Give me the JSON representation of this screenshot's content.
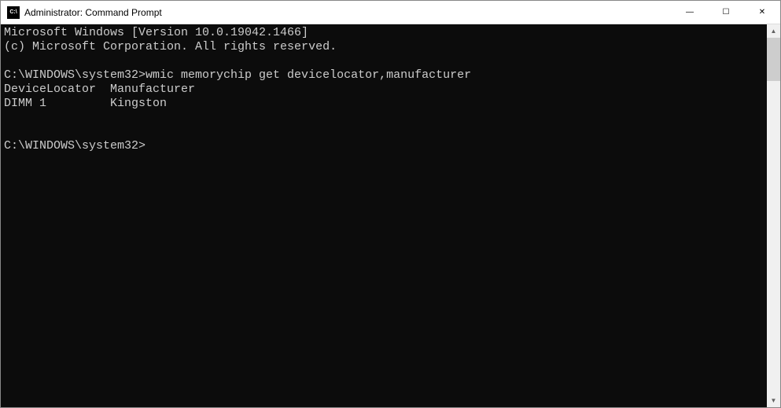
{
  "titlebar": {
    "icon_label": "C:\\",
    "title": "Administrator: Command Prompt"
  },
  "window_controls": {
    "minimize": "—",
    "maximize": "☐",
    "close": "✕"
  },
  "terminal": {
    "line1": "Microsoft Windows [Version 10.0.19042.1466]",
    "line2": "(c) Microsoft Corporation. All rights reserved.",
    "blank1": "",
    "line3": "C:\\WINDOWS\\system32>wmic memorychip get devicelocator,manufacturer",
    "line4": "DeviceLocator  Manufacturer",
    "line5": "DIMM 1         Kingston",
    "blank2": "",
    "blank3": "",
    "line6": "C:\\WINDOWS\\system32>"
  },
  "scrollbar": {
    "up_arrow": "▲",
    "down_arrow": "▼"
  }
}
